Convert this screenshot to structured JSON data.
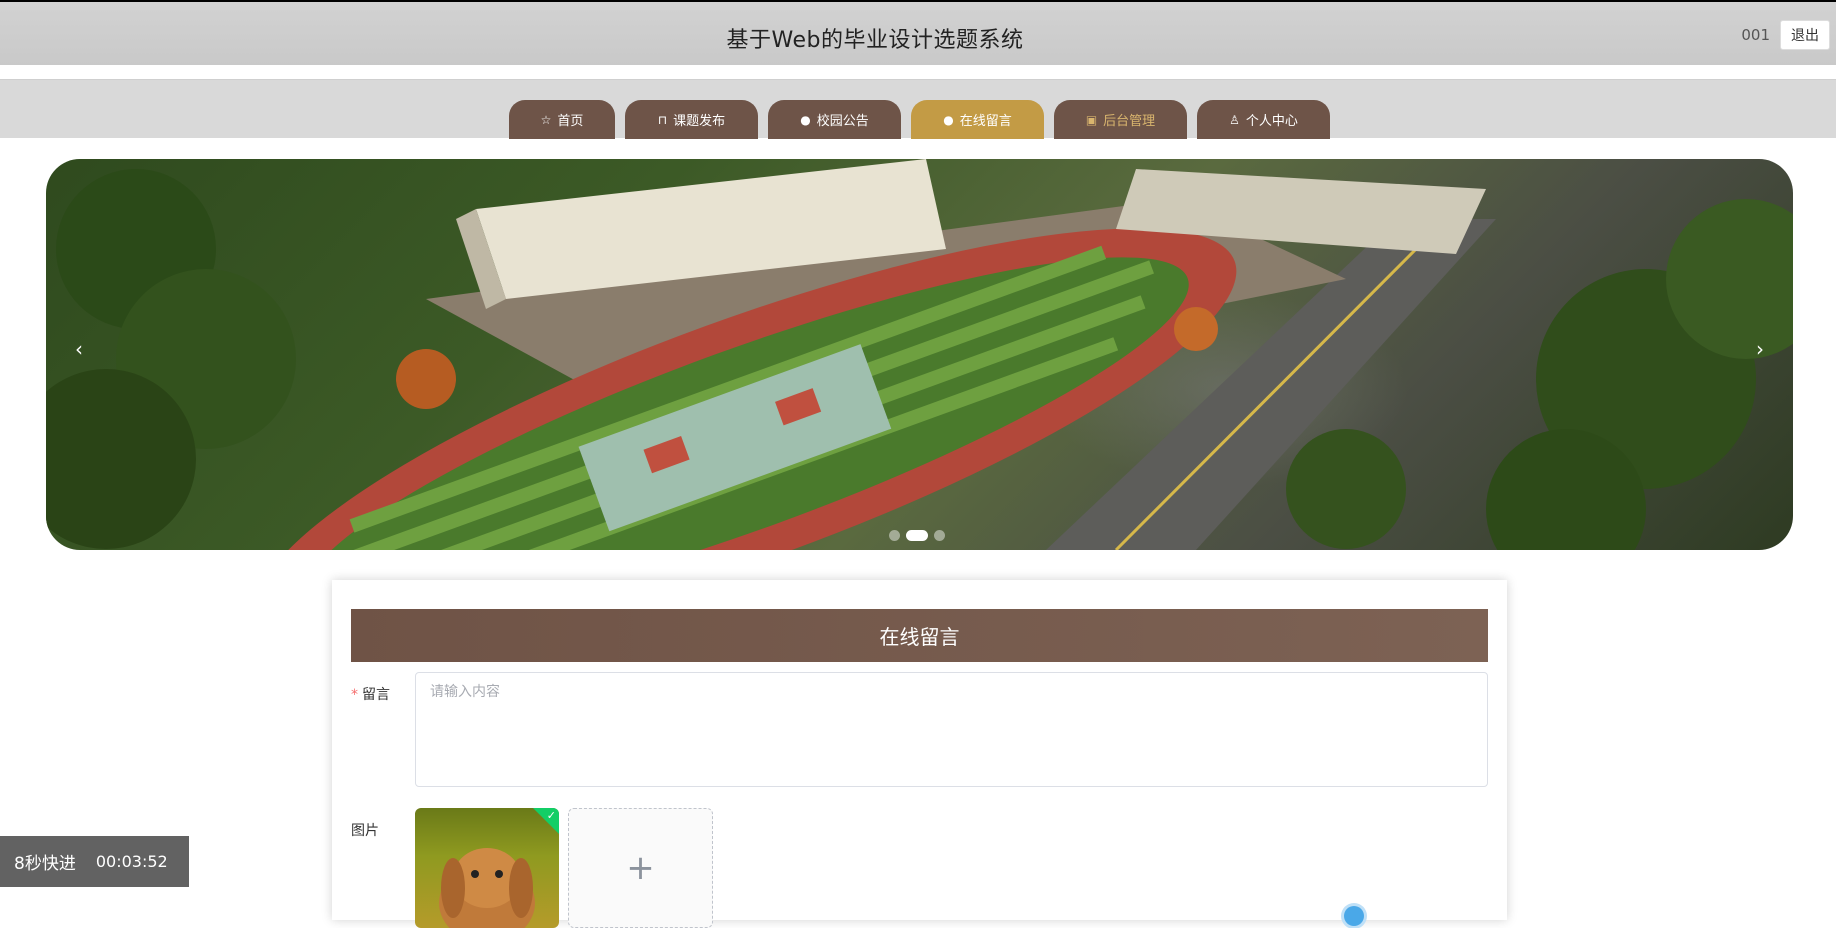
{
  "header": {
    "title": "基于Web的毕业设计选题系统",
    "username": "001",
    "logout_label": "退出"
  },
  "nav": {
    "items": [
      {
        "label": "首页",
        "icon": "star-icon"
      },
      {
        "label": "课题发布",
        "icon": "bag-icon"
      },
      {
        "label": "校园公告",
        "icon": "info-icon"
      },
      {
        "label": "在线留言",
        "icon": "question-icon",
        "active": true
      },
      {
        "label": "后台管理",
        "icon": "briefcase-icon"
      },
      {
        "label": "个人中心",
        "icon": "user-icon"
      }
    ],
    "colors": {
      "default": "#6e5448",
      "active": "#c39b45"
    }
  },
  "carousel": {
    "prev_arrow": "‹",
    "next_arrow": "›",
    "dots_count": 3,
    "active_dot": 1
  },
  "form": {
    "title": "在线留言",
    "message_label": "留言",
    "message_placeholder": "请输入内容",
    "message_value": "",
    "image_label": "图片",
    "upload_plus": "+"
  },
  "overlay": {
    "speed_label": "8秒快进",
    "time": "00:03:52"
  }
}
